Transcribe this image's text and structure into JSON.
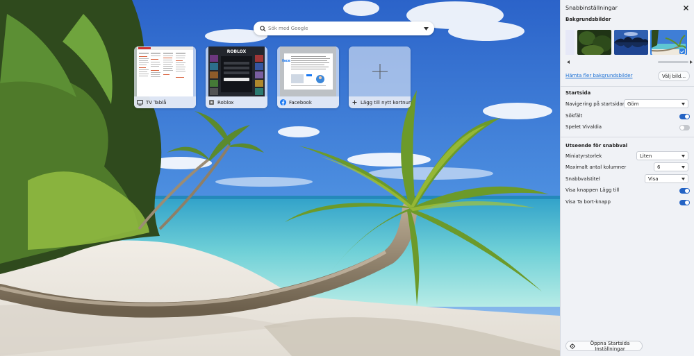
{
  "search": {
    "placeholder": "Sök med Google",
    "icon": "google-search-icon"
  },
  "speed_dials": [
    {
      "label": "TV Tablå",
      "icon": "tv-icon"
    },
    {
      "label": "Roblox",
      "icon": "roblox-icon"
    },
    {
      "label": "Facebook",
      "icon": "facebook-icon",
      "icon_color": "#1877f2"
    },
    {
      "label": "Lägg till nytt kortnum...",
      "icon": "plus-icon"
    }
  ],
  "panel": {
    "title": "Snabbinställningar",
    "close_icon": "close-icon",
    "backgrounds": {
      "title": "Bakgrundsbilder",
      "more_link": "Hämta fler bakgrundsbilder",
      "choose_button": "Välj bild..."
    },
    "startpage": {
      "title": "Startsida",
      "rows": [
        {
          "label": "Navigering på startsidan",
          "type": "select",
          "value": "Göm"
        },
        {
          "label": "Sökfält",
          "type": "toggle",
          "on": true
        },
        {
          "label": "Spelet Vivaldia",
          "type": "toggle",
          "on": false
        }
      ]
    },
    "speed_dial_appearance": {
      "title": "Utseende för snabbval",
      "rows": [
        {
          "label": "Miniatyrstorlek",
          "type": "select",
          "value": "Liten"
        },
        {
          "label": "Maximalt antal kolumner",
          "type": "select",
          "value": "6"
        },
        {
          "label": "Snabbvalstitel",
          "type": "select",
          "value": "Visa"
        },
        {
          "label": "Visa knappen Lägg till",
          "type": "toggle",
          "on": true
        },
        {
          "label": "Visa Ta bort-knapp",
          "type": "toggle",
          "on": true
        }
      ]
    },
    "open_settings_button": "Öppna Startsida Inställningar",
    "accent_color": "#2463c4"
  }
}
